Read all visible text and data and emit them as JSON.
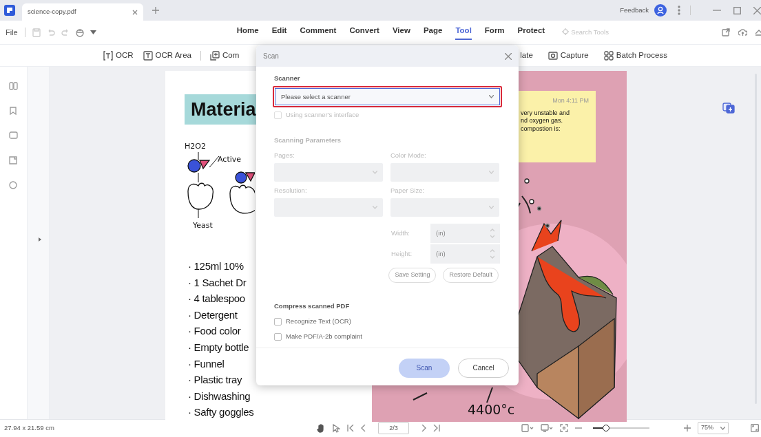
{
  "titlebar": {
    "tab_title": "science-copy.pdf",
    "feedback": "Feedback"
  },
  "menu": {
    "file": "File",
    "tabs": [
      {
        "label": "Home",
        "selected": false
      },
      {
        "label": "Edit",
        "selected": false
      },
      {
        "label": "Comment",
        "selected": false
      },
      {
        "label": "Convert",
        "selected": false
      },
      {
        "label": "View",
        "selected": false
      },
      {
        "label": "Page",
        "selected": false
      },
      {
        "label": "Tool",
        "selected": true
      },
      {
        "label": "Form",
        "selected": false
      },
      {
        "label": "Protect",
        "selected": false
      }
    ],
    "search_placeholder": "Search Tools"
  },
  "ribbon": {
    "left": [
      {
        "label": "OCR",
        "kind": "ocr"
      },
      {
        "label": "OCR Area",
        "kind": "area"
      },
      {
        "label": "Com",
        "kind": "combine"
      }
    ],
    "right": [
      {
        "label": "late",
        "kind": "none"
      },
      {
        "label": "Capture",
        "kind": "capture"
      },
      {
        "label": "Batch Process",
        "kind": "batch"
      }
    ]
  },
  "document": {
    "heading": "Materia",
    "diagram_labels": [
      "H2O2",
      "Active",
      "Yeast"
    ],
    "items": [
      "· 125ml 10%",
      "· 1 Sachet Dr",
      "· 4 tablespoo",
      "· Detergent",
      "· Food color",
      "· Empty bottle",
      "· Funnel",
      "· Plastic tray",
      "· Dishwashing",
      "· Safty goggles"
    ],
    "note": {
      "time": "Mon 4:11 PM",
      "lines": [
        "very unstable and",
        "nd oxygen gas.",
        "compostion is:"
      ]
    },
    "temperature": "4400°c"
  },
  "dialog": {
    "title": "Scan",
    "scanner_label": "Scanner",
    "scanner_placeholder": "Please select a scanner",
    "scanner_highlighted": true,
    "use_interface": {
      "label": "Using scanner's interface",
      "checked": false,
      "disabled": true
    },
    "params_title": "Scanning Parameters",
    "params": [
      {
        "label": "Pages:",
        "disabled": true
      },
      {
        "label": "Color Mode:",
        "disabled": true
      },
      {
        "label": "Resolution:",
        "disabled": true
      },
      {
        "label": "Paper Size:",
        "disabled": true
      }
    ],
    "sizes": [
      {
        "label": "Width:",
        "placeholder": "(in)",
        "disabled": true
      },
      {
        "label": "Height:",
        "placeholder": "(in)",
        "disabled": true
      }
    ],
    "setting_buttons": [
      {
        "label": "Save Setting",
        "disabled": true
      },
      {
        "label": "Restore Default",
        "disabled": true
      }
    ],
    "compress_title": "Compress scanned PDF",
    "options": [
      {
        "label": "Recognize Text (OCR)",
        "checked": false
      },
      {
        "label": "Make PDF/A-2b complaint",
        "checked": false
      }
    ],
    "scan": {
      "label": "Scan",
      "disabled": true
    },
    "cancel": "Cancel"
  },
  "statusbar": {
    "dimensions": "27.94 x 21.59 cm",
    "page": "2/3",
    "zoom_slider": {
      "level": 0.23
    },
    "zoom": "75%"
  }
}
